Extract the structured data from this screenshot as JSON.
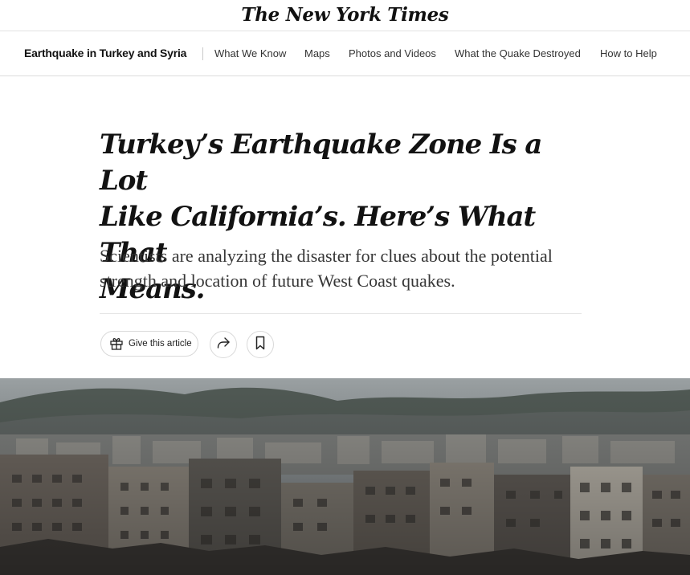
{
  "masthead": {
    "logo": "The New York Times"
  },
  "nav": {
    "title": "Earthquake in Turkey and Syria",
    "links": [
      "What We Know",
      "Maps",
      "Photos and Videos",
      "What the Quake Destroyed",
      "How to Help"
    ]
  },
  "article": {
    "headline_lines": [
      "Turkey’s Earthquake Zone Is a Lot",
      "Like California’s. Here’s What That",
      "Means."
    ],
    "summary_lines": [
      "Scientists are analyzing the disaster for clues about the potential",
      "strength and location of future West Coast quakes."
    ]
  },
  "actions": {
    "give_label": "Give this article",
    "icons": [
      "gift-icon",
      "share-icon",
      "bookmark-icon"
    ]
  },
  "hero_image": {
    "subject": "aerial view of dense city buildings on a hillside under a hazy sky"
  }
}
